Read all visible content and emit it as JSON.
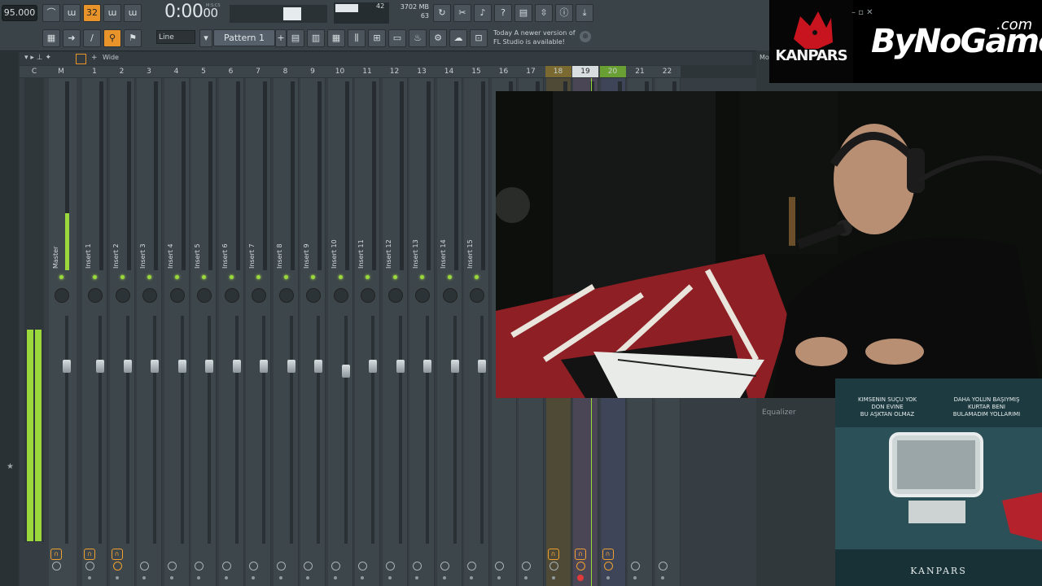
{
  "toolbar": {
    "tempo": "95.000",
    "time": "0:00",
    "time_sub": "00",
    "time_unit": "M:S:CS",
    "cpu": "42",
    "memory": "3702 MB",
    "polyphony": "63",
    "snap": "Line",
    "pattern": "Pattern 1",
    "news_line1": "Today  A newer version of",
    "news_line2": "FL Studio is available!",
    "btn_32": "32"
  },
  "mixer": {
    "view_mode": "Wide",
    "col_c": "C",
    "col_m": "M",
    "track_numbers": [
      "1",
      "2",
      "3",
      "4",
      "5",
      "6",
      "7",
      "8",
      "9",
      "10",
      "11",
      "12",
      "13",
      "14",
      "15",
      "16",
      "17",
      "18",
      "19",
      "20",
      "21",
      "22"
    ],
    "master_label": "Master",
    "insert_labels": [
      "Insert 1",
      "Insert 2",
      "Insert 3",
      "Insert 4",
      "Insert 5",
      "Insert 6",
      "Insert 7",
      "Insert 8",
      "Insert 9",
      "Insert 10",
      "Insert 11",
      "Insert 12",
      "Insert 13",
      "Insert 14",
      "Insert 15"
    ],
    "side_label": "Equalizer",
    "side_title": "Mo"
  },
  "overlay": {
    "brand_text": "ByNoGame",
    "brand_suffix": ".com",
    "logo_text": "KANPARS",
    "album_left_line1": "KIMSENIN SUÇU YOK",
    "album_left_line2": "DON EVINE",
    "album_left_line3": "BU AŞKTAN OLMAZ",
    "album_right_line1": "DAHA YOLUN BAŞIYMIŞ",
    "album_right_line2": "KURTAR BENI",
    "album_right_line3": "BULAMADIM YOLLARIMI",
    "album_artist": "KANPARS"
  },
  "colors": {
    "accent": "#e8942a",
    "meter_green": "#9ad83c",
    "brand_red": "#c8141e"
  }
}
